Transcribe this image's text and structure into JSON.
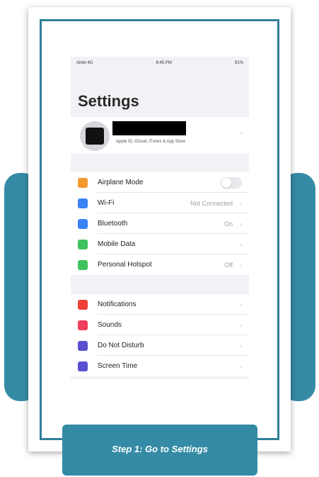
{
  "colors": {
    "accent": "#358ba5",
    "frame": "#2f7f99"
  },
  "status_bar": {
    "carrier": "Airtel 4G",
    "time": "8:45 PM",
    "battery": "91%"
  },
  "settings": {
    "title": "Settings",
    "profile_subtitle": "Apple ID, iCloud, iTunes & App Store",
    "group1": [
      {
        "label": "Airplane Mode",
        "value": "",
        "icon_color": "#f29a2e",
        "icon": "airplane-icon",
        "toggle": true
      },
      {
        "label": "Wi-Fi",
        "value": "Not Connected",
        "icon_color": "#3a82f7",
        "icon": "wifi-icon"
      },
      {
        "label": "Bluetooth",
        "value": "On",
        "icon_color": "#3a82f7",
        "icon": "bluetooth-icon"
      },
      {
        "label": "Mobile Data",
        "value": "",
        "icon_color": "#3fc25f",
        "icon": "mobile-data-icon"
      },
      {
        "label": "Personal Hotspot",
        "value": "Off",
        "icon_color": "#3fc25f",
        "icon": "hotspot-icon"
      }
    ],
    "group2": [
      {
        "label": "Notifications",
        "value": "",
        "icon_color": "#ee4036",
        "icon": "notifications-icon"
      },
      {
        "label": "Sounds",
        "value": "",
        "icon_color": "#ee3e5a",
        "icon": "sounds-icon"
      },
      {
        "label": "Do Not Disturb",
        "value": "",
        "icon_color": "#5a4fcf",
        "icon": "moon-icon"
      },
      {
        "label": "Screen Time",
        "value": "",
        "icon_color": "#5a4fcf",
        "icon": "hourglass-icon"
      }
    ]
  },
  "caption": "Step 1: Go to Settings"
}
